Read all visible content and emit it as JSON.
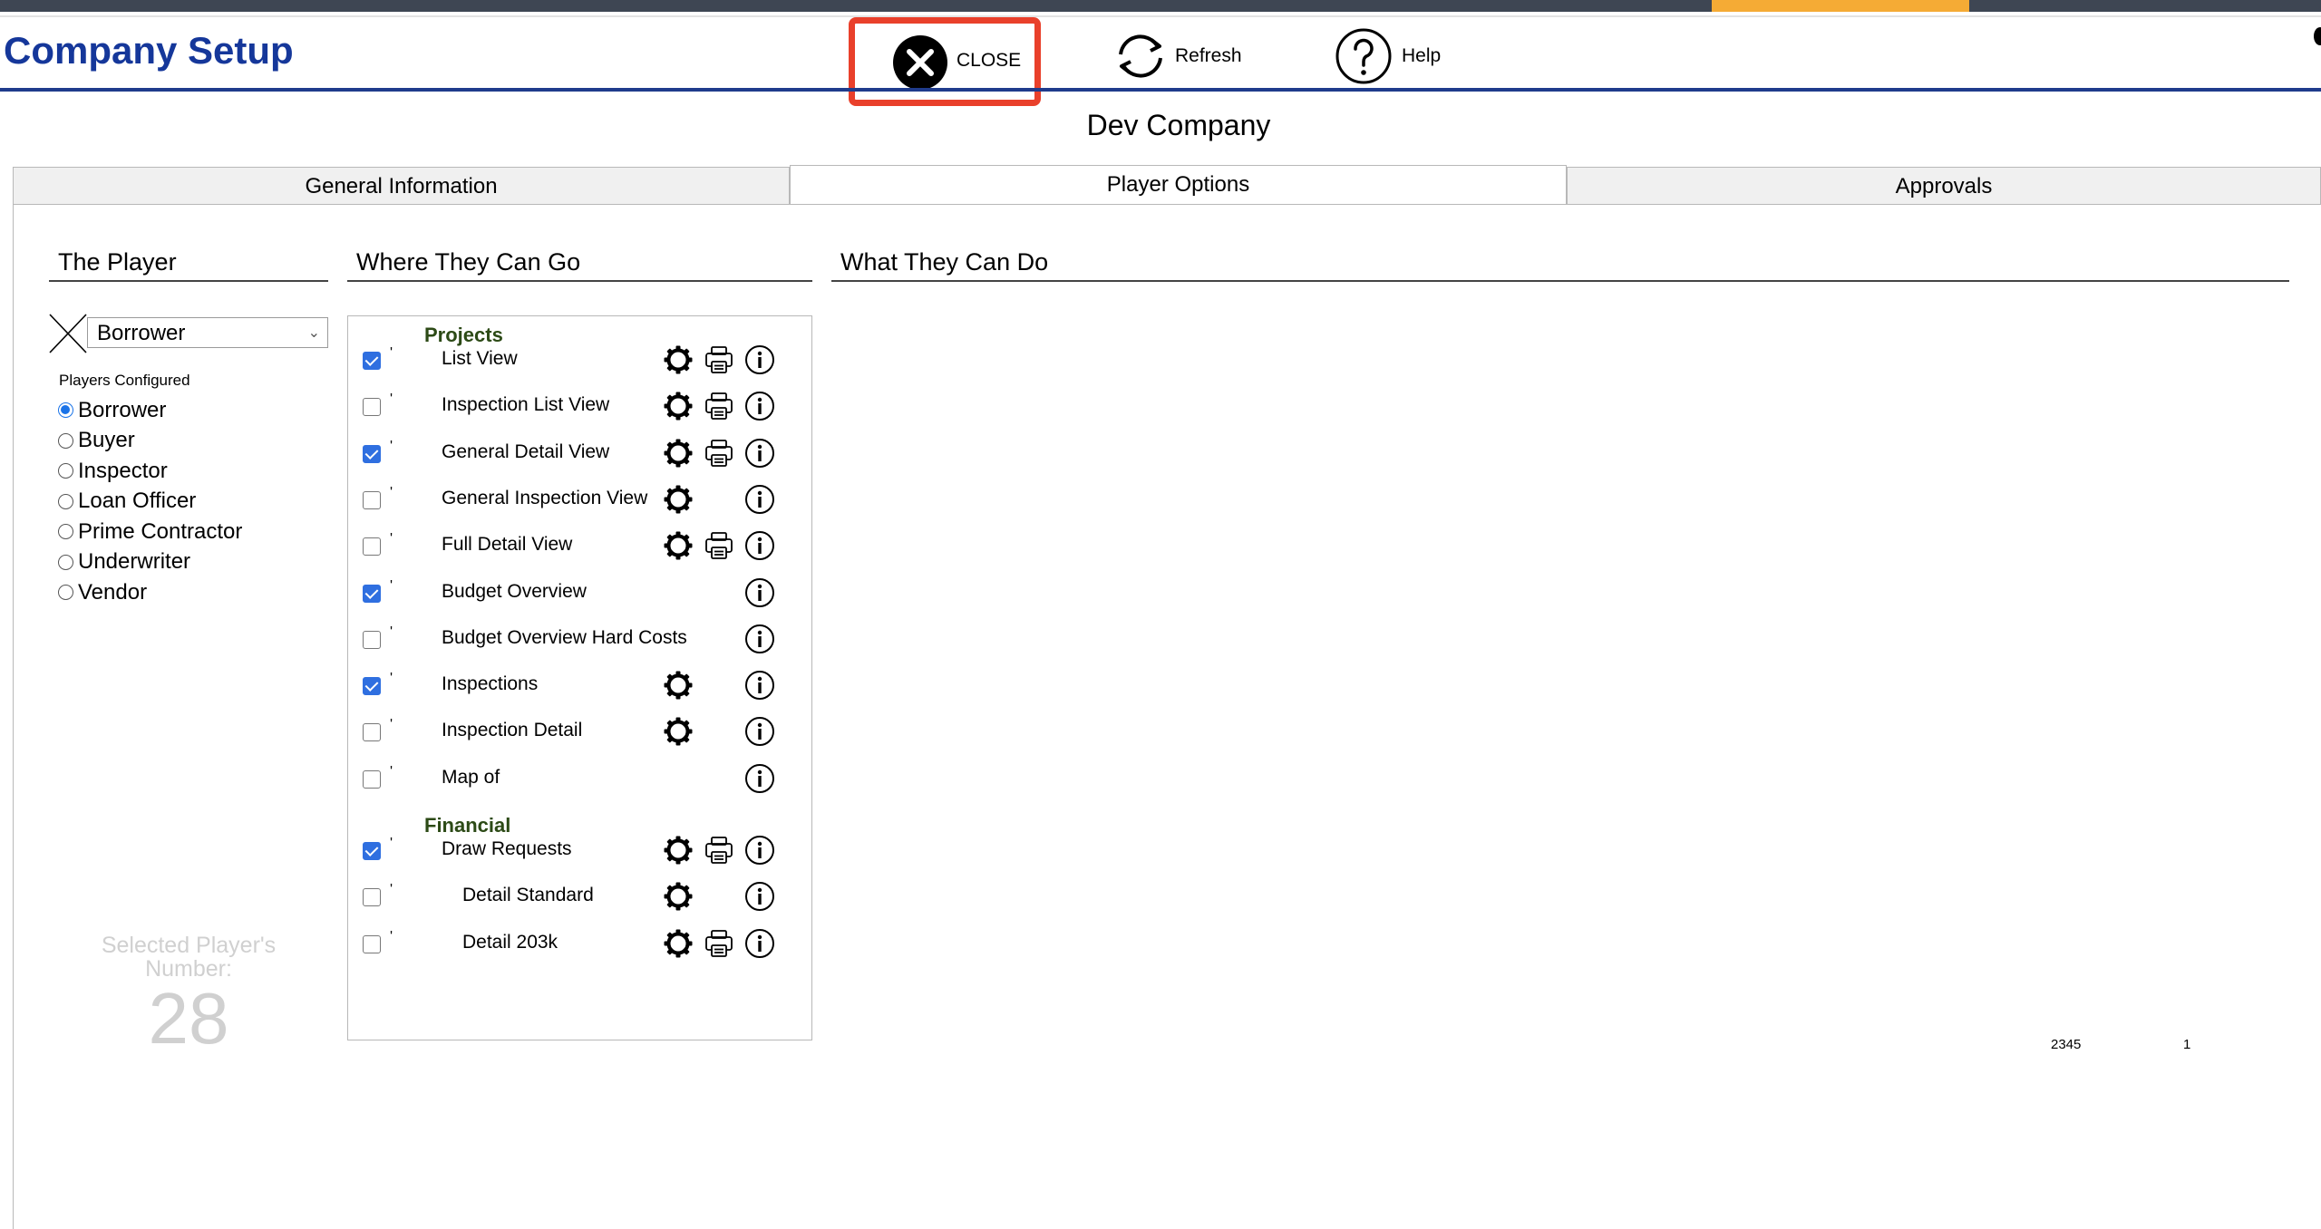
{
  "header": {
    "title": "Company Setup",
    "close_label": "CLOSE",
    "refresh_label": "Refresh",
    "help_label": "Help"
  },
  "company_name": "Dev Company",
  "tabs": [
    {
      "label": "General Information",
      "active": false
    },
    {
      "label": "Player Options",
      "active": true
    },
    {
      "label": "Approvals",
      "active": false
    }
  ],
  "sections": {
    "player": "The Player",
    "where": "Where They Can Go",
    "what": "What They Can Do"
  },
  "player_select": {
    "value": "Borrower"
  },
  "players_configured_label": "Players Configured",
  "players": [
    {
      "label": "Borrower",
      "selected": true
    },
    {
      "label": "Buyer",
      "selected": false
    },
    {
      "label": "Inspector",
      "selected": false
    },
    {
      "label": "Loan Officer",
      "selected": false
    },
    {
      "label": "Prime Contractor",
      "selected": false
    },
    {
      "label": "Underwriter",
      "selected": false
    },
    {
      "label": "Vendor",
      "selected": false
    }
  ],
  "selected_player": {
    "caption": "Selected Player's Number:",
    "number": "28"
  },
  "groups": [
    {
      "title": "Projects",
      "items": [
        {
          "label": "List View",
          "checked": true,
          "gear": true,
          "print": true,
          "info": true,
          "indent": false
        },
        {
          "label": "Inspection List View",
          "checked": false,
          "gear": true,
          "print": true,
          "info": true,
          "indent": false
        },
        {
          "label": "General Detail View",
          "checked": true,
          "gear": true,
          "print": true,
          "info": true,
          "indent": false
        },
        {
          "label": "General Inspection View",
          "checked": false,
          "gear": true,
          "print": false,
          "info": true,
          "indent": false
        },
        {
          "label": "Full Detail View",
          "checked": false,
          "gear": true,
          "print": true,
          "info": true,
          "indent": false
        },
        {
          "label": "Budget Overview",
          "checked": true,
          "gear": false,
          "print": false,
          "info": true,
          "indent": false
        },
        {
          "label": "Budget Overview Hard Costs",
          "checked": false,
          "gear": false,
          "print": false,
          "info": true,
          "indent": false
        },
        {
          "label": "Inspections",
          "checked": true,
          "gear": true,
          "print": false,
          "info": true,
          "indent": false
        },
        {
          "label": "Inspection Detail",
          "checked": false,
          "gear": true,
          "print": false,
          "info": true,
          "indent": false
        },
        {
          "label": "Map of",
          "checked": false,
          "gear": false,
          "print": false,
          "info": true,
          "indent": false
        }
      ]
    },
    {
      "title": "Financial",
      "items": [
        {
          "label": "Draw Requests",
          "checked": true,
          "gear": true,
          "print": true,
          "info": true,
          "indent": false
        },
        {
          "label": "Detail Standard",
          "checked": false,
          "gear": true,
          "print": false,
          "info": true,
          "indent": true
        },
        {
          "label": "Detail 203k",
          "checked": false,
          "gear": true,
          "print": true,
          "info": true,
          "indent": true
        }
      ]
    }
  ],
  "row_tick": "'",
  "footer": {
    "left": "2345",
    "right": "1"
  },
  "colors": {
    "brand": "#15379a",
    "accent": "#f5ab35",
    "highlight": "#e9402b",
    "group_title": "#2c4a16"
  }
}
